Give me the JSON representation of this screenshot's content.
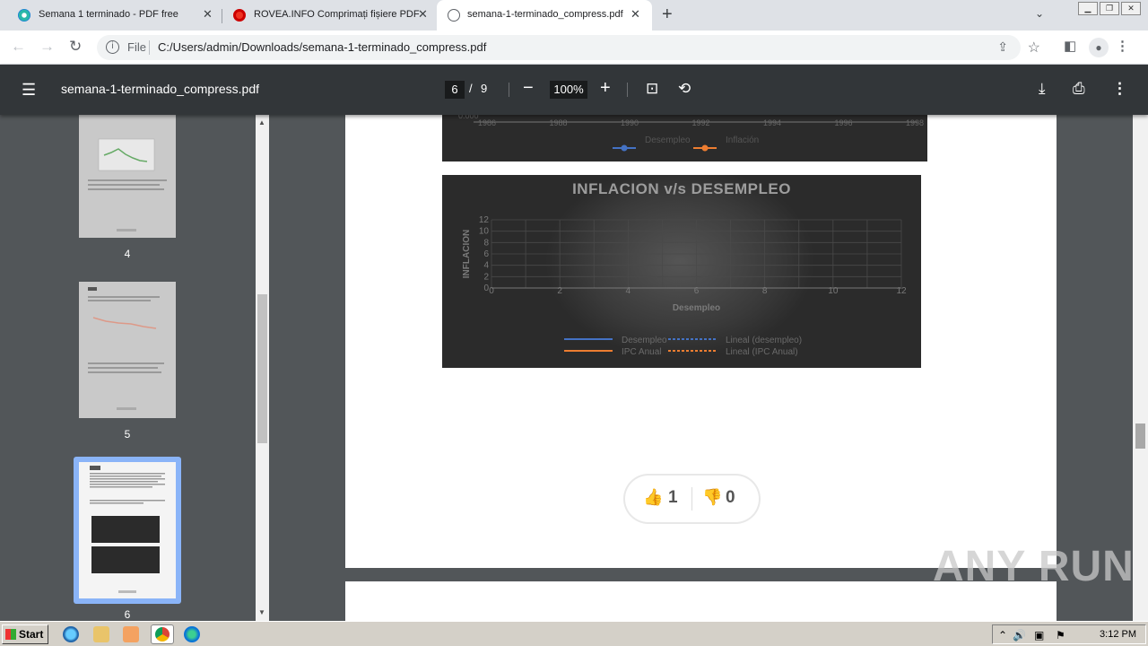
{
  "browser": {
    "tabs": [
      {
        "title": "Semana 1 terminado - PDF free",
        "active": false
      },
      {
        "title": "ROVEA.INFO Comprimați fișiere PDF",
        "active": false
      },
      {
        "title": "semana-1-terminado_compress.pdf",
        "active": true
      }
    ],
    "new_tab_icon": "+",
    "address": {
      "scheme_label": "File",
      "url": "C:/Users/admin/Downloads/semana-1-terminado_compress.pdf"
    }
  },
  "pdf_viewer": {
    "title": "semana-1-terminado_compress.pdf",
    "current_page": "6",
    "page_separator": "/",
    "total_pages": "9",
    "zoom": "100%"
  },
  "thumbnails": [
    {
      "label": "4",
      "selected": false
    },
    {
      "label": "5",
      "selected": false
    },
    {
      "label": "6",
      "selected": true
    }
  ],
  "chart_top": {
    "x_ticks": [
      "1986",
      "1988",
      "1990",
      "1992",
      "1994",
      "1996",
      "1998"
    ],
    "y_tick": "0.000",
    "legend": [
      "Desempleo",
      "Inflación"
    ]
  },
  "chart_data": {
    "type": "scatter",
    "title": "INFLACION v/s DESEMPLEO",
    "xlabel": "Desempleo",
    "ylabel": "INFLACION",
    "x_ticks": [
      "0",
      "2",
      "4",
      "6",
      "8",
      "10",
      "12"
    ],
    "y_ticks": [
      "0",
      "2",
      "4",
      "6",
      "8",
      "10",
      "12"
    ],
    "xlim": [
      0,
      12
    ],
    "ylim": [
      0,
      12
    ],
    "legend": [
      "Desempleo",
      "Lineal (desempleo)",
      "IPC Anual",
      "Lineal (IPC Anual)"
    ],
    "series_colors": [
      "#4472c4",
      "#4472c4",
      "#ed7d31",
      "#ed7d31"
    ]
  },
  "votes": {
    "up": "1",
    "down": "0"
  },
  "watermark": "ANY RUN",
  "taskbar": {
    "start": "Start",
    "time": "3:12 PM"
  }
}
